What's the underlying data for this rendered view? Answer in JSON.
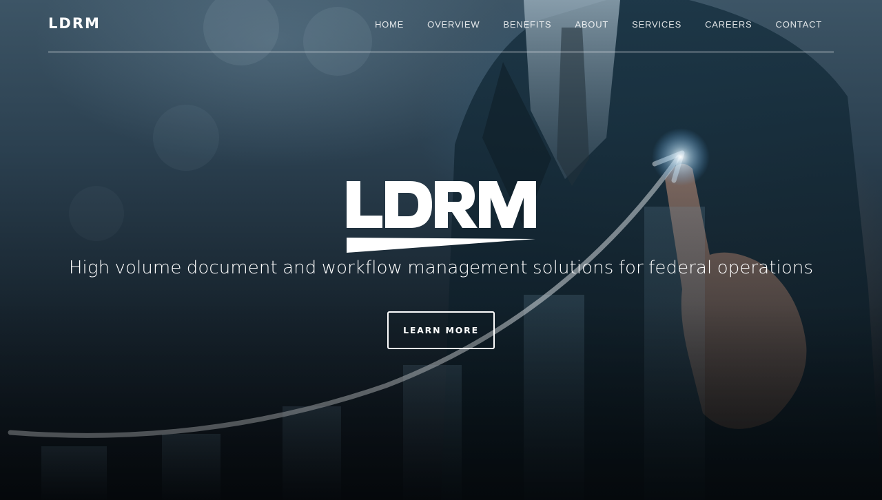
{
  "header": {
    "brand": "LDRM",
    "nav": [
      "HOME",
      "OVERVIEW",
      "BENEFITS",
      "ABOUT",
      "SERVICES",
      "CAREERS",
      "CONTACT"
    ]
  },
  "hero": {
    "logo_text": "LDRM",
    "tagline": "High volume document and workflow management solutions for federal operations",
    "cta_label": "LEARN MORE"
  },
  "colors": {
    "text": "#ffffff",
    "background_dark": "#0a1118",
    "background_light": "#3d5566"
  },
  "icons": {
    "background": "businessman-pointing-growth-arrow-image"
  }
}
